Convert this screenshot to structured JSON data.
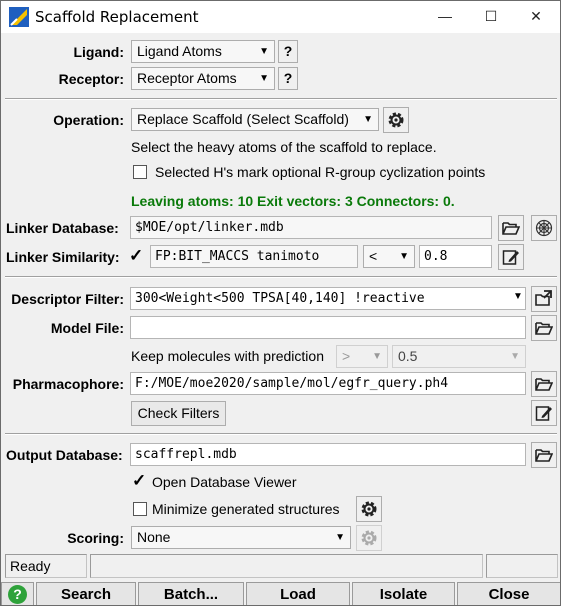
{
  "window": {
    "title": "Scaffold Replacement",
    "minimize_glyph": "—",
    "maximize_glyph": "☐",
    "close_glyph": "✕"
  },
  "ligand": {
    "label": "Ligand:",
    "value": "Ligand Atoms",
    "help": "?"
  },
  "receptor": {
    "label": "Receptor:",
    "value": "Receptor Atoms",
    "help": "?"
  },
  "operation": {
    "label": "Operation:",
    "value": "Replace Scaffold (Select Scaffold)",
    "instruction": "Select the heavy atoms of the scaffold to replace.",
    "hydrogen_checkbox_label": "Selected H's mark optional R-group cyclization points",
    "hydrogen_checked": false,
    "summary": "Leaving atoms: 10   Exit vectors: 3   Connectors: 0."
  },
  "linker_database": {
    "label": "Linker Database:",
    "value": "$MOE/opt/linker.mdb"
  },
  "linker_similarity": {
    "label": "Linker Similarity:",
    "checked": true,
    "fingerprint": "FP:BIT_MACCS tanimoto",
    "comparator": "<",
    "threshold": "0.8"
  },
  "descriptor_filter": {
    "label": "Descriptor Filter:",
    "value": "300<Weight<500 TPSA[40,140] !reactive"
  },
  "model_file": {
    "label": "Model File:",
    "value": ""
  },
  "prediction": {
    "label": "Keep molecules with prediction",
    "comparator": ">",
    "value": "0.5"
  },
  "pharmacophore": {
    "label": "Pharmacophore:",
    "value": "F:/MOE/moe2020/sample/mol/egfr_query.ph4"
  },
  "check_filters": {
    "label": "Check Filters"
  },
  "output_database": {
    "label": "Output Database:",
    "value": "scaffrepl.mdb"
  },
  "open_viewer": {
    "label": "Open Database Viewer",
    "checked": true
  },
  "minimize": {
    "label": "Minimize generated structures",
    "checked": false
  },
  "scoring": {
    "label": "Scoring:",
    "value": "None"
  },
  "status": {
    "text": "Ready"
  },
  "footer": {
    "help": "?",
    "search": "Search",
    "batch": "Batch...",
    "load": "Load",
    "isolate": "Isolate",
    "close": "Close"
  },
  "colors": {
    "accent_green": "#0a7a0a",
    "help_green": "#2ea23a"
  }
}
